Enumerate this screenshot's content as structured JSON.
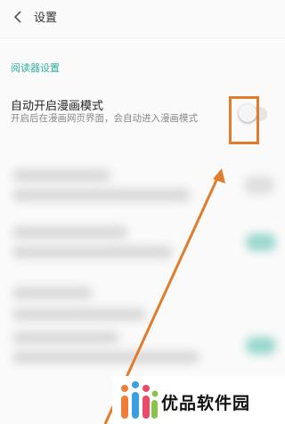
{
  "header": {
    "title": "设置"
  },
  "section": {
    "label": "阅读器设置"
  },
  "item": {
    "title": "自动开启漫画模式",
    "description": "开启后在漫画网页界面，会自动进入漫画模式",
    "toggle_on": false
  },
  "colors": {
    "accent": "#2fb0a0",
    "highlight": "#e07d2c"
  },
  "watermark": {
    "text": "优品软件园"
  }
}
